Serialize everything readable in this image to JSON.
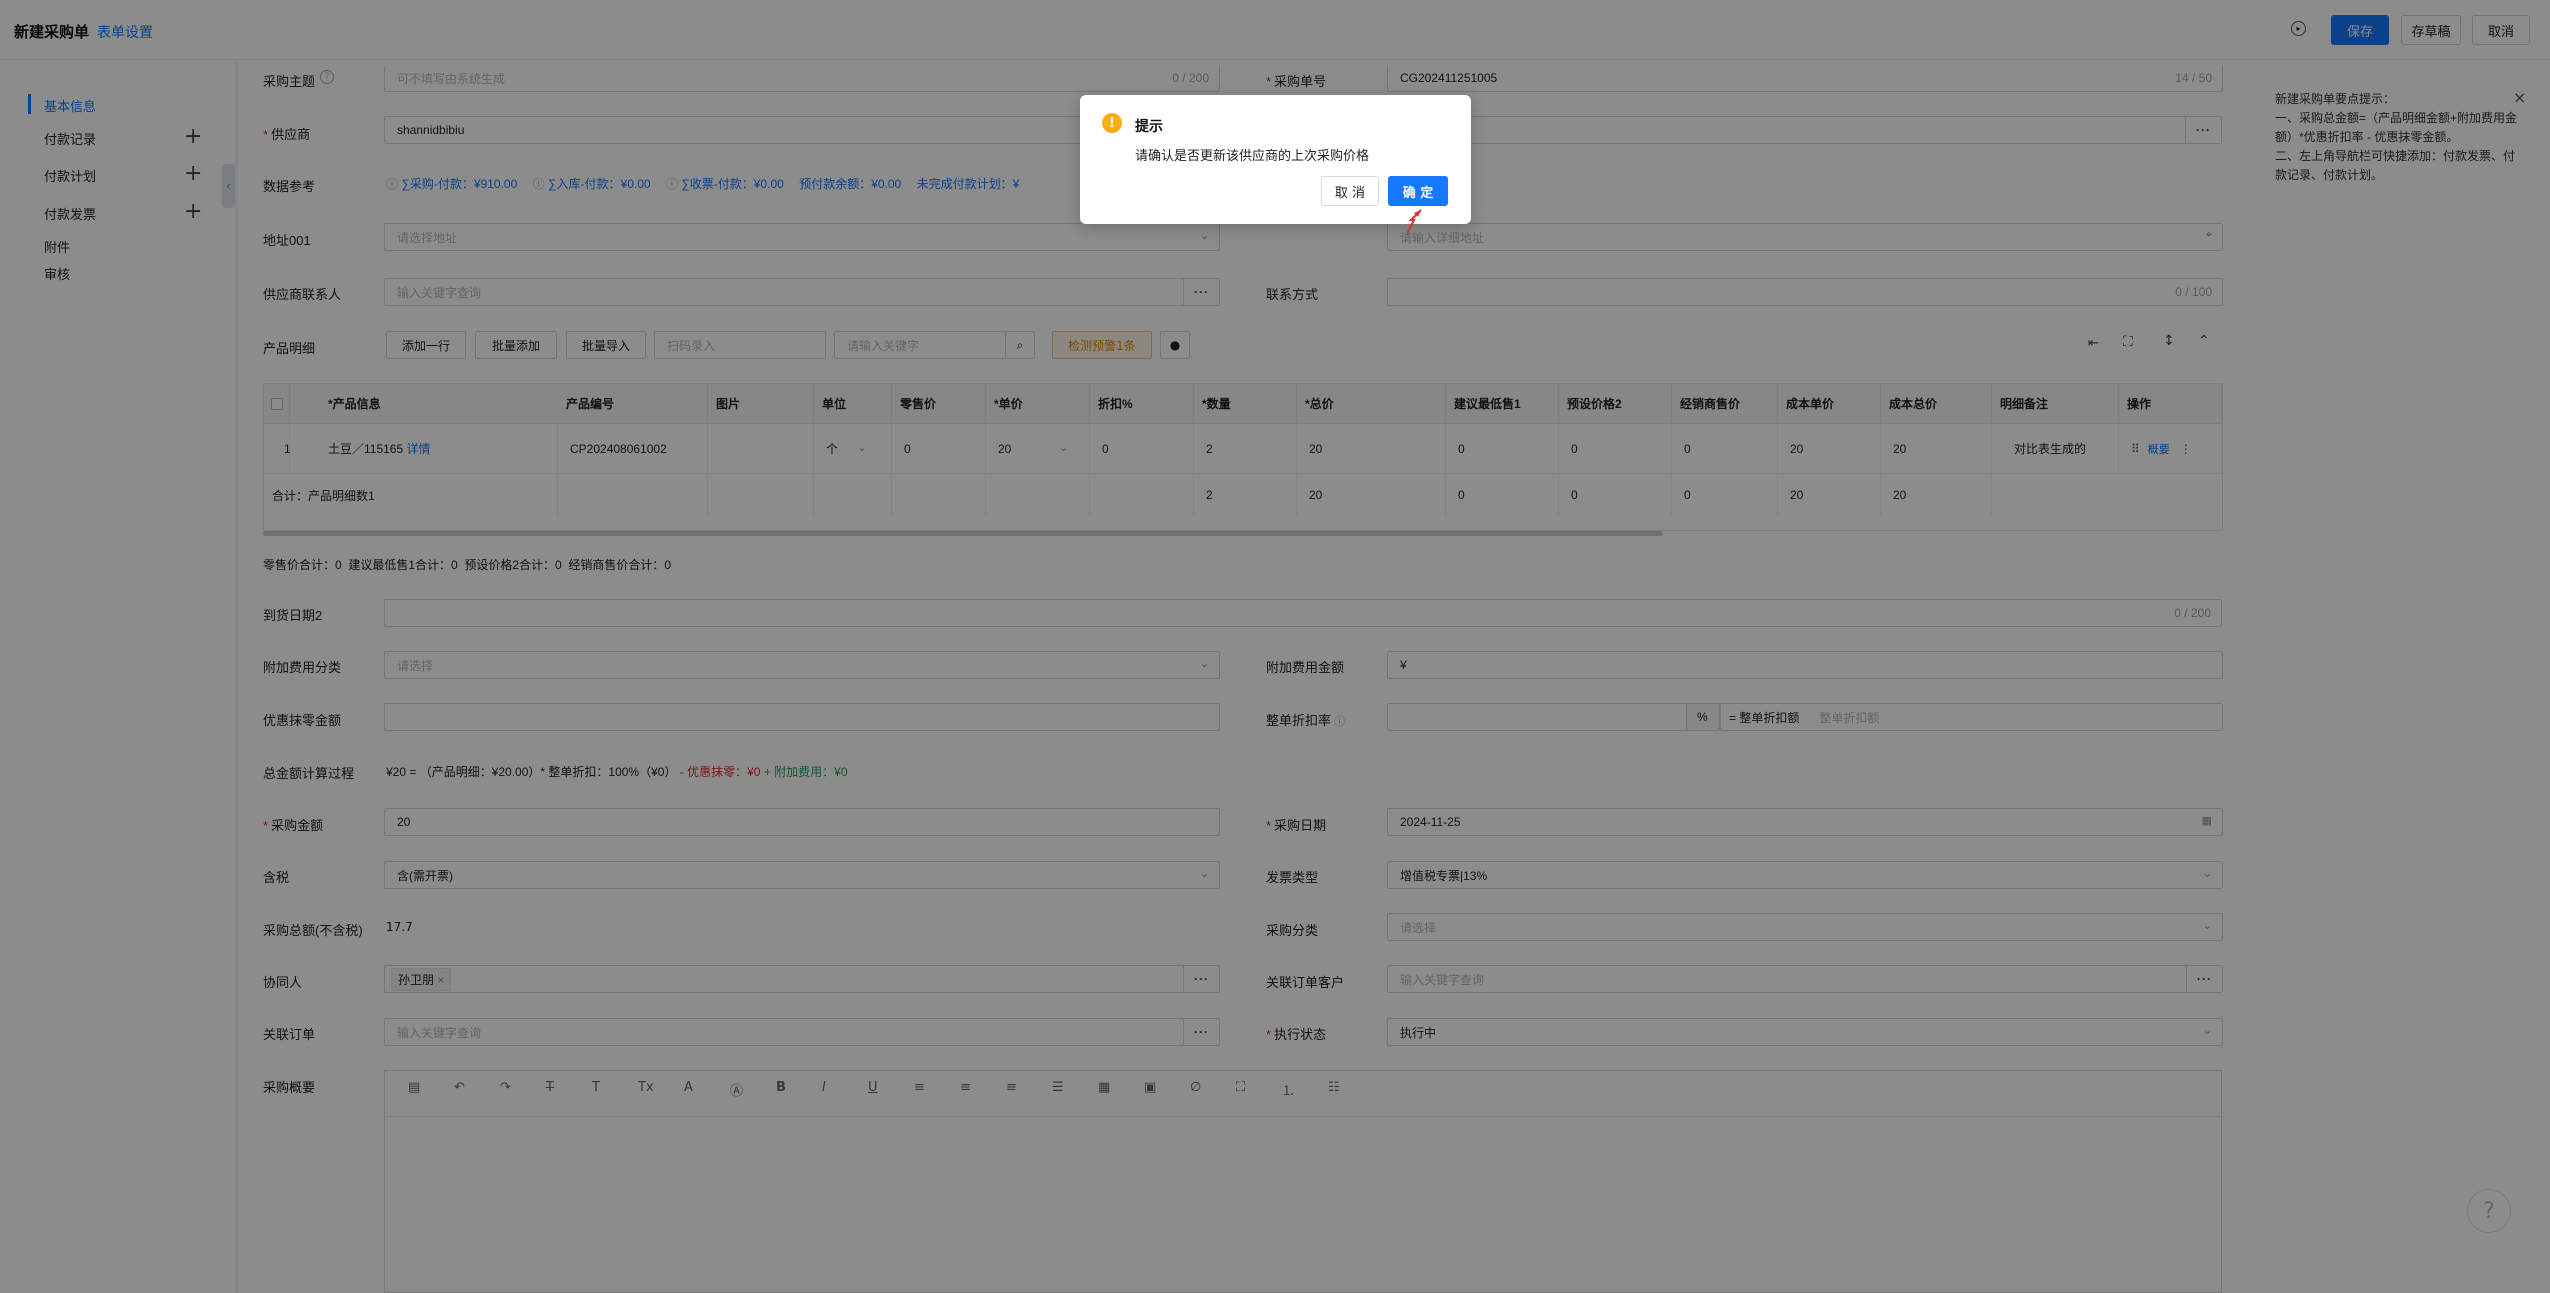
{
  "topbar": {
    "title": "新建采购单",
    "form_settings": "表单设置",
    "save": "保存",
    "draft": "存草稿",
    "cancel": "取消"
  },
  "sidebar": {
    "items": [
      {
        "label": "基本信息",
        "active": true
      },
      {
        "label": "付款记录",
        "plus": "+"
      },
      {
        "label": "付款计划",
        "plus": "+"
      },
      {
        "label": "付款发票",
        "plus": "+"
      },
      {
        "label": "附件"
      },
      {
        "label": "审核"
      }
    ]
  },
  "form": {
    "subject_label": "采购主题",
    "subject_placeholder": "可不填写由系统生成",
    "subject_counter": "0 / 200",
    "order_no_label": "采购单号",
    "order_no_value": "CG202411251005",
    "order_no_counter": "14 / 50",
    "supplier_label": "供应商",
    "supplier_value": "shannidbibiu",
    "data_ref_label": "数据参考",
    "data_ref": {
      "a": "∑采购-付款：¥910.00",
      "b": "∑入库-付款：¥0.00",
      "c": "∑收票-付款：¥0.00",
      "d": "预付款余额：¥0.00",
      "e": "未完成付款计划：¥"
    },
    "address_label": "地址001",
    "address_placeholder": "请选择地址",
    "detail_address_placeholder": "请输入详细地址",
    "contact_label": "供应商联系人",
    "contact_placeholder": "输入关键字查询",
    "contact_way_label": "联系方式",
    "contact_way_counter": "0 / 100",
    "products_label": "产品明细",
    "add_row": "添加一行",
    "batch_add": "批量添加",
    "batch_import": "批量导入",
    "scan_placeholder": "扫码录入",
    "keyword_placeholder": "请输入关键字",
    "check_warning": "检测预警1条",
    "sum_line": "零售价合计：0  建议最低售1合计：0  预设价格2合计：0  经销商售价合计：0",
    "arrival_label": "到货日期2",
    "arrival_counter": "0 / 200",
    "extra_cat_label": "附加费用分类",
    "extra_cat_placeholder": "请选择",
    "extra_amt_label": "附加费用金额",
    "extra_amt_value": "¥",
    "discount_label": "优惠抹零金额",
    "order_discount_label": "整单折扣率",
    "percent": "%",
    "discount_amt_prefix": "= 整单折扣额",
    "discount_amt_placeholder": "整单折扣额",
    "calc_label": "总金额计算过程",
    "calc_main": "¥20 = （产品明细：¥20.00）* 整单折扣：100%（¥0）",
    "calc_minus": "- 优惠抹零：¥0",
    "calc_plus": "+ 附加费用：¥0",
    "amount_label": "采购金额",
    "amount_value": "20",
    "date_label": "采购日期",
    "date_value": "2024-11-25",
    "tax_label": "含税",
    "tax_value": "含(需开票)",
    "invoice_label": "发票类型",
    "invoice_value": "增值税专票|13%",
    "net_label": "采购总额(不含税)",
    "net_value": "17.7",
    "category_label": "采购分类",
    "category_placeholder": "请选择",
    "coworker_label": "协同人",
    "coworker_tag": "孙卫朋",
    "customer_label": "关联订单客户",
    "customer_placeholder": "输入关键字查询",
    "related_label": "关联订单",
    "related_placeholder": "输入关键字查询",
    "exec_label": "执行状态",
    "exec_value": "执行中",
    "summary_label": "采购概要"
  },
  "table": {
    "headers": [
      "*产品信息",
      "产品编号",
      "图片",
      "单位",
      "零售价",
      "*单价",
      "折扣%",
      "*数量",
      "*总价",
      "建议最低售1",
      "预设价格2",
      "经销商售价",
      "成本单价",
      "成本总价",
      "明细备注",
      "操作"
    ],
    "row": {
      "index": "1",
      "product": "土豆／115165",
      "detail": "详情",
      "code": "CP202408061002",
      "unit": "个",
      "retail": "0",
      "price": "20",
      "discount": "0",
      "qty": "2",
      "total": "20",
      "min1": "0",
      "preset2": "0",
      "dealer": "0",
      "cost_unit": "20",
      "cost_total": "20",
      "note": "对比表生成的",
      "op_link": "概要"
    },
    "footer": {
      "label": "合计：产品明细数1",
      "qty": "2",
      "total": "20",
      "min1": "0",
      "preset2": "0",
      "dealer": "0",
      "cost_unit": "20",
      "cost_total": "20"
    }
  },
  "tips": {
    "title": "新建采购单要点提示：",
    "line1": "一、采购总金额=（产品明细金额+附加费用金额）*优惠折扣率 - 优惠抹零金额。",
    "line2": "二、左上角导航栏可快捷添加：付款发票、付款记录、付款计划。"
  },
  "dialog": {
    "title": "提示",
    "message": "请确认是否更新该供应商的上次采购价格",
    "cancel": "取 消",
    "confirm": "确 定"
  }
}
